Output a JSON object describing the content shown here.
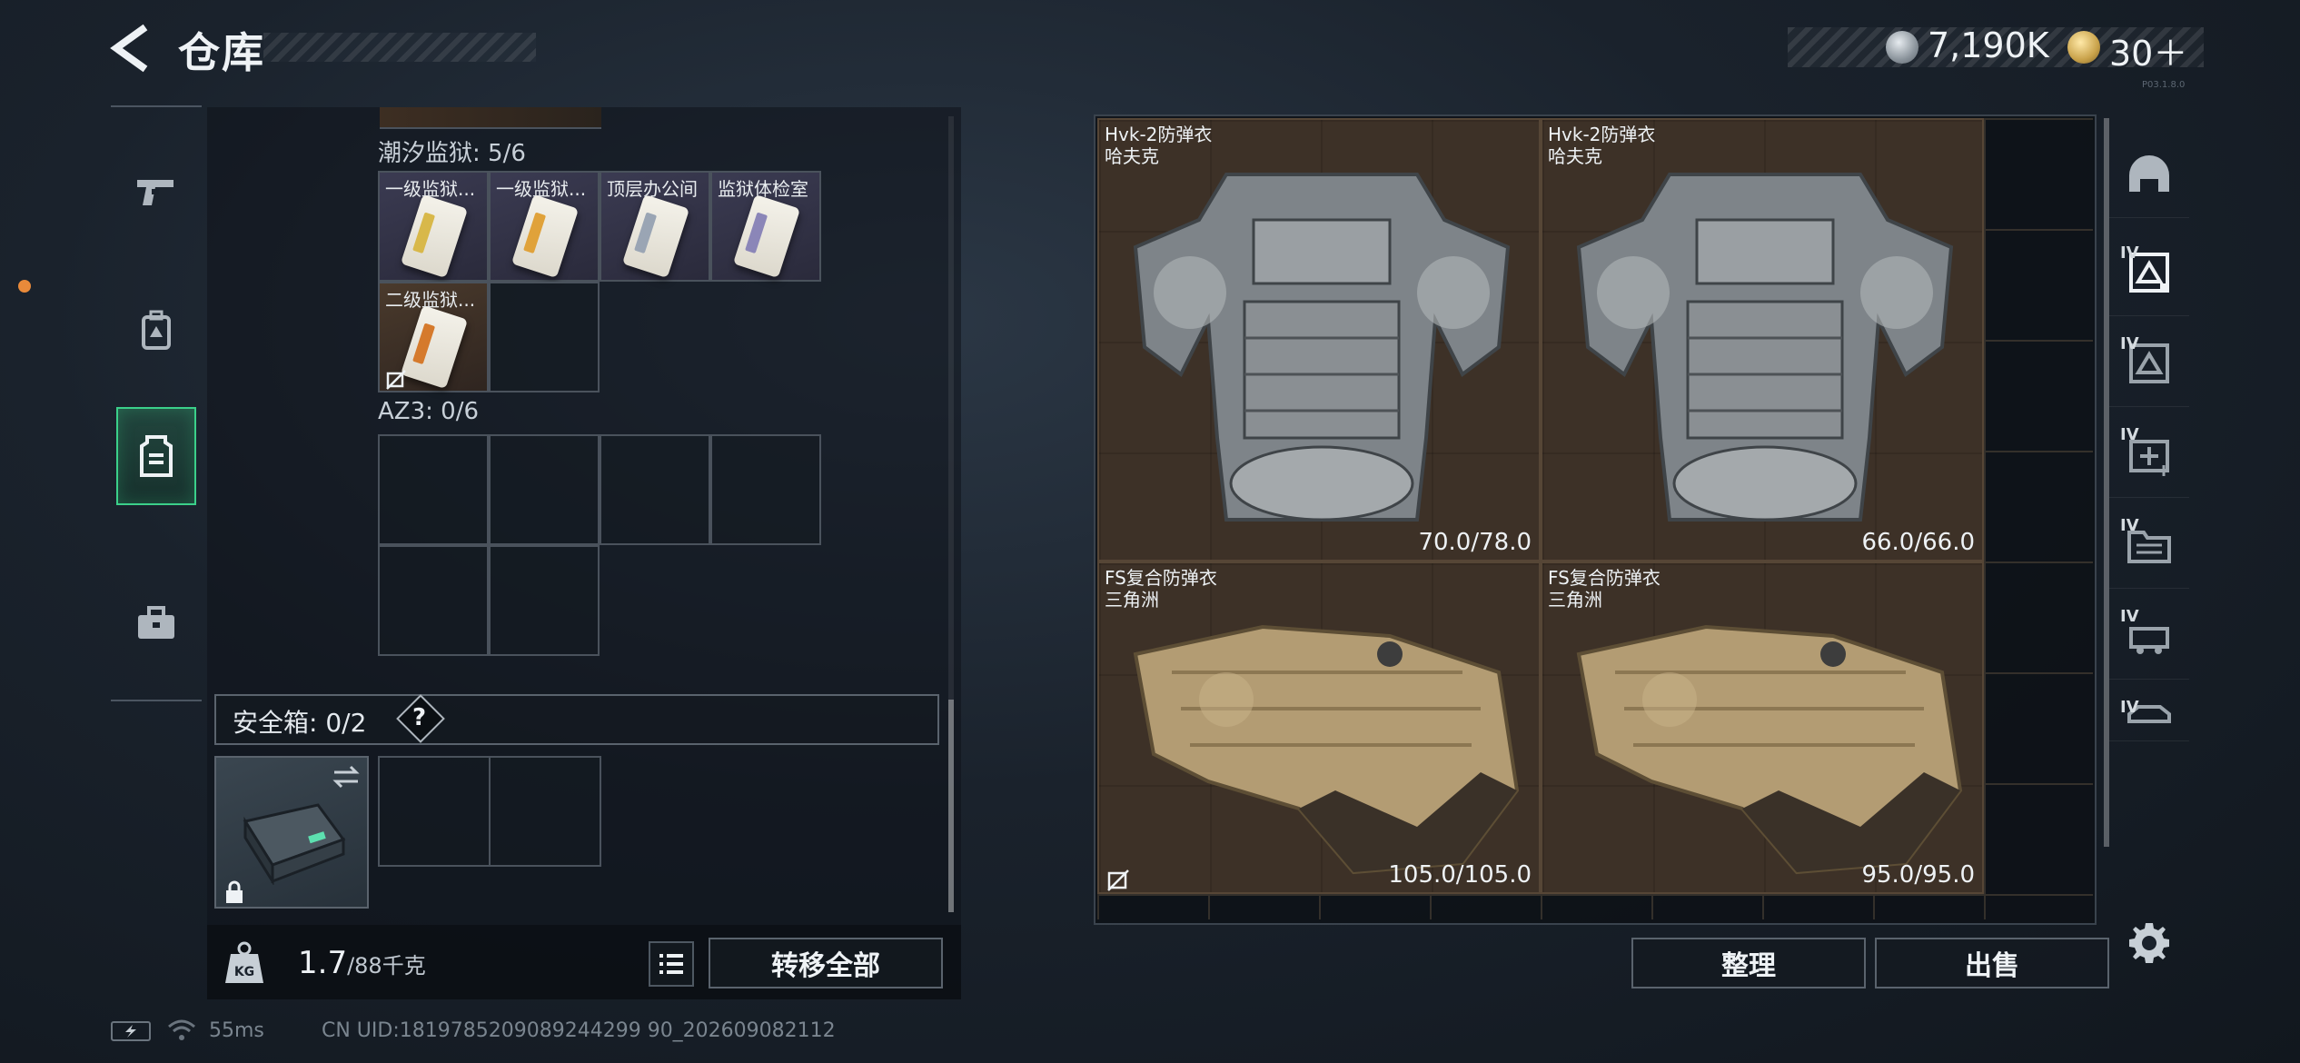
{
  "header": {
    "title": "仓库",
    "currency": {
      "silver": "7,190K",
      "gold": "30＋"
    },
    "version": "P03.1.8.0"
  },
  "side_nav": {
    "items": [
      {
        "name": "weapons",
        "icon": "pistol-icon"
      },
      {
        "name": "equipment",
        "icon": "backpack-icon"
      },
      {
        "name": "storage",
        "icon": "vest-icon",
        "active": true
      },
      {
        "name": "cases",
        "icon": "briefcase-icon"
      }
    ]
  },
  "inventory": {
    "section1": {
      "label": "潮汐监狱: 5/6"
    },
    "cards": [
      {
        "label": "一级监狱...",
        "strip": "#d8b84a"
      },
      {
        "label": "一级监狱...",
        "strip": "#e0a23a"
      },
      {
        "label": "顶层办公间",
        "strip": "#9aa5b4"
      },
      {
        "label": "监狱体检室",
        "strip": "#8b86b8"
      },
      {
        "label": "二级监狱...",
        "strip": "#d57a2c"
      }
    ],
    "section2": {
      "label": "AZ3: 0/6"
    },
    "safebox": {
      "label": "安全箱: 0/2",
      "help": "?"
    }
  },
  "weight": {
    "current": "1.7",
    "max": "/88千克"
  },
  "buttons": {
    "transfer_all": "转移全部",
    "sort": "整理",
    "sell": "出售"
  },
  "status": {
    "ping": "55ms",
    "uid": "CN UID:1819785209089244299 90_202609082112"
  },
  "storage": {
    "items": [
      {
        "name": "Hvk-2防弹衣",
        "brand": "哈夫克",
        "durability": "70.0/78.0",
        "type": "gray"
      },
      {
        "name": "Hvk-2防弹衣",
        "brand": "哈夫克",
        "durability": "66.0/66.0",
        "type": "gray"
      },
      {
        "name": "FS复合防弹衣",
        "brand": "三角洲",
        "durability": "105.0/105.0",
        "type": "tan",
        "locked": true
      },
      {
        "name": "FS复合防弹衣",
        "brand": "三角洲",
        "durability": "95.0/95.0",
        "type": "tan"
      }
    ]
  },
  "filters": {
    "tier": "IV",
    "items": [
      {
        "name": "helmet-filter",
        "icon": "helmet-icon"
      },
      {
        "name": "armor-filter",
        "icon": "armor-icon",
        "active": true
      },
      {
        "name": "armor-alt-filter",
        "icon": "armor-icon"
      },
      {
        "name": "medical-filter",
        "icon": "medkit-icon"
      },
      {
        "name": "folder-filter",
        "icon": "folder-icon"
      },
      {
        "name": "device-filter",
        "icon": "device-icon"
      },
      {
        "name": "vehicle-filter",
        "icon": "vehicle-icon"
      }
    ]
  }
}
